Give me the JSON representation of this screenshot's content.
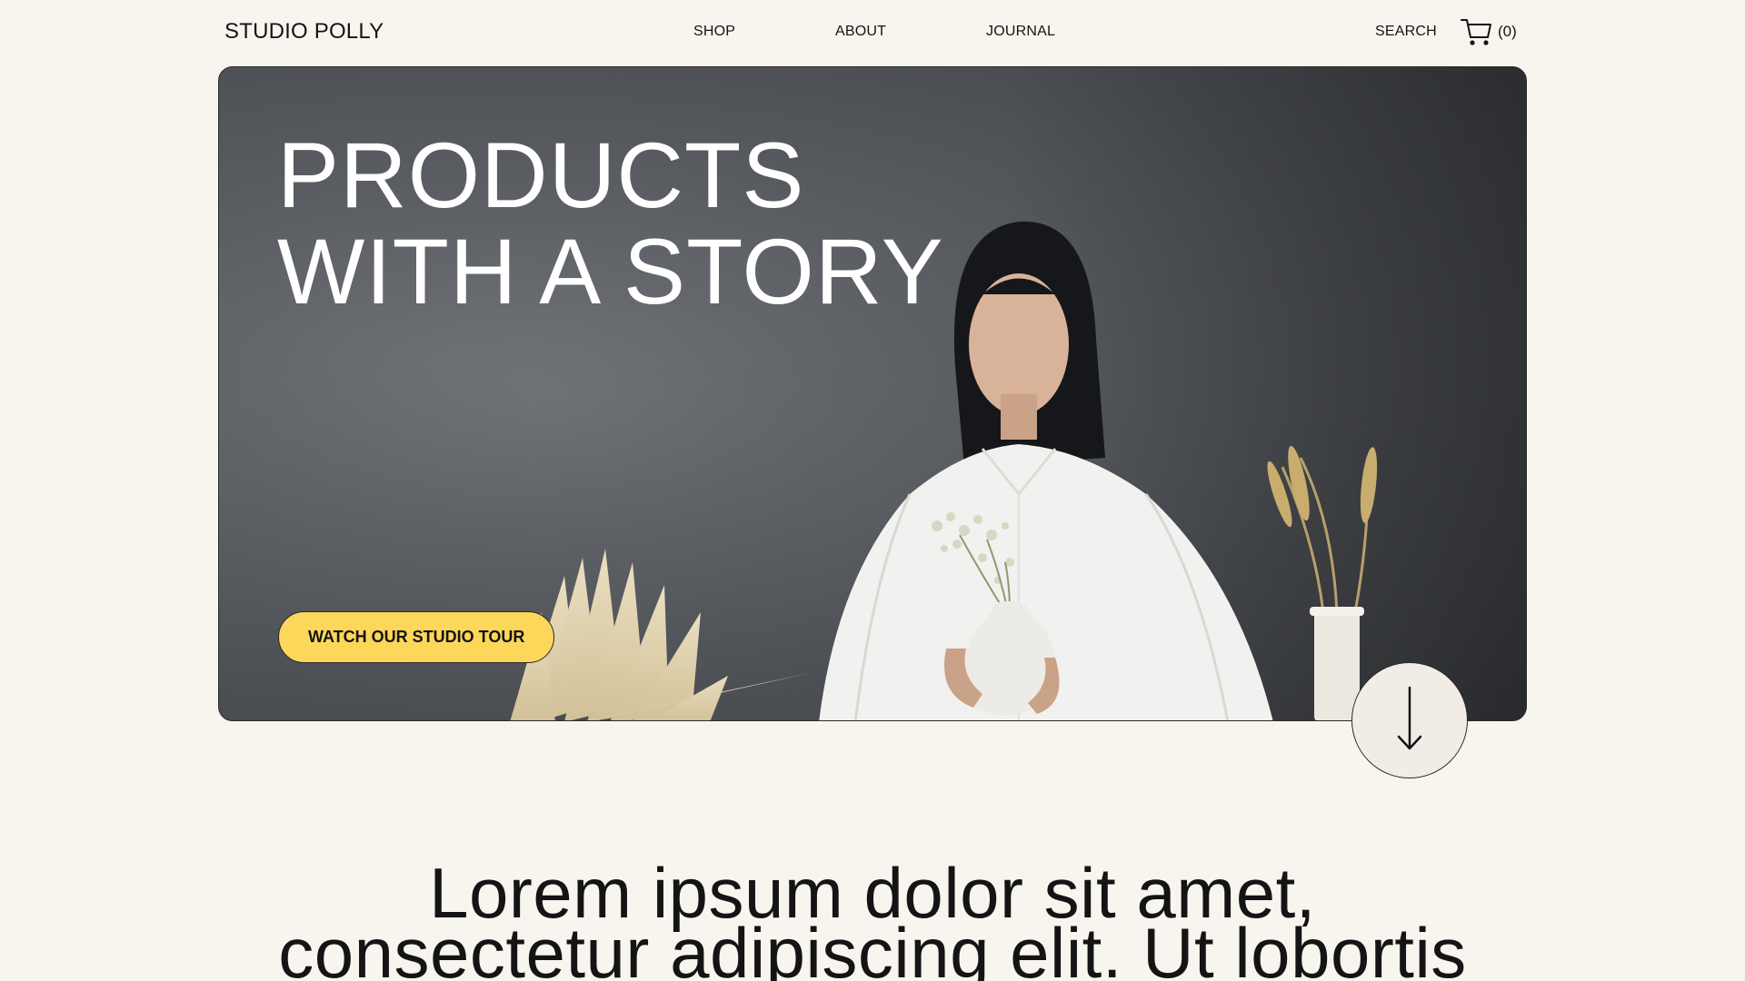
{
  "header": {
    "logo": "STUDIO POLLY",
    "nav": {
      "shop": "SHOP",
      "about": "ABOUT",
      "journal": "JOURNAL"
    },
    "search_label": "SEARCH",
    "cart_count": "(0)",
    "cart_icon": "cart-icon"
  },
  "hero": {
    "title_line1": "PRODUCTS",
    "title_line2": "WITH A STORY",
    "cta_label": "WATCH OUR STUDIO TOUR",
    "image": "hero-photo-woman-holding-vase",
    "accent_color": "#fcd75a"
  },
  "scroll_button": {
    "icon": "arrow-down-icon"
  },
  "intro": {
    "line1": "Lorem ipsum dolor sit amet,",
    "line2": "consectetur adipiscing elit. Ut lobortis"
  },
  "colors": {
    "background": "#f8f5ef",
    "text": "#141414",
    "accent": "#fcd75a"
  }
}
